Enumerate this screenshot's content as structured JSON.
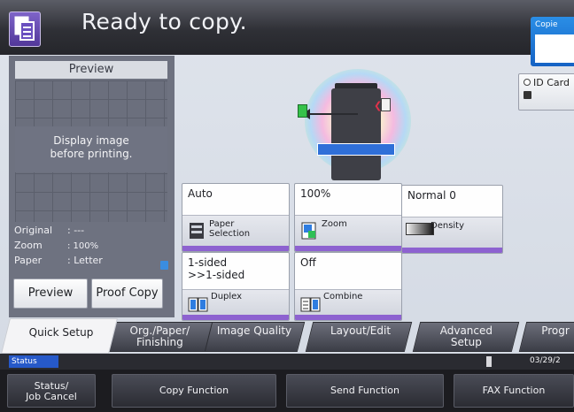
{
  "header": {
    "title": "Ready to copy.",
    "copies_label": "Copie"
  },
  "preview": {
    "title": "Preview",
    "message_line1": "Display image",
    "message_line2": "before printing.",
    "info": [
      {
        "label": "Original",
        "value": ": ---"
      },
      {
        "label": "Zoom",
        "value": ": 100%"
      },
      {
        "label": "Paper",
        "value": ": Letter"
      }
    ],
    "preview_button": "Preview",
    "proof_copy_button": "Proof Copy"
  },
  "id_card": {
    "label": "ID Card"
  },
  "tiles": {
    "paper": {
      "value": "Auto",
      "label_line1": "Paper",
      "label_line2": "Selection"
    },
    "zoom": {
      "value": "100%",
      "label": "Zoom"
    },
    "density": {
      "value": "Normal 0",
      "label": "Density"
    },
    "duplex": {
      "value_line1": "1-sided",
      "value_line2": ">>1-sided",
      "label": "Duplex"
    },
    "combine": {
      "value": "Off",
      "label": "Combine"
    }
  },
  "tabs": [
    {
      "line1": "Quick Setup",
      "line2": ""
    },
    {
      "line1": "Org./Paper/",
      "line2": "Finishing"
    },
    {
      "line1": "Image Quality",
      "line2": ""
    },
    {
      "line1": "Layout/Edit",
      "line2": ""
    },
    {
      "line1": "Advanced",
      "line2": "Setup"
    },
    {
      "line1": "Progr",
      "line2": ""
    }
  ],
  "status_bar": {
    "status_label": "Status",
    "date": "03/29/2"
  },
  "bottom_buttons": {
    "status_job_cancel_line1": "Status/",
    "status_job_cancel_line2": "Job Cancel",
    "copy_function": "Copy Function",
    "send_function": "Send Function",
    "fax_function": "FAX Function"
  },
  "colors": {
    "accent_purple": "#8d62d0",
    "status_blue": "#2659c9",
    "copies_blue": "#1f78d8"
  }
}
